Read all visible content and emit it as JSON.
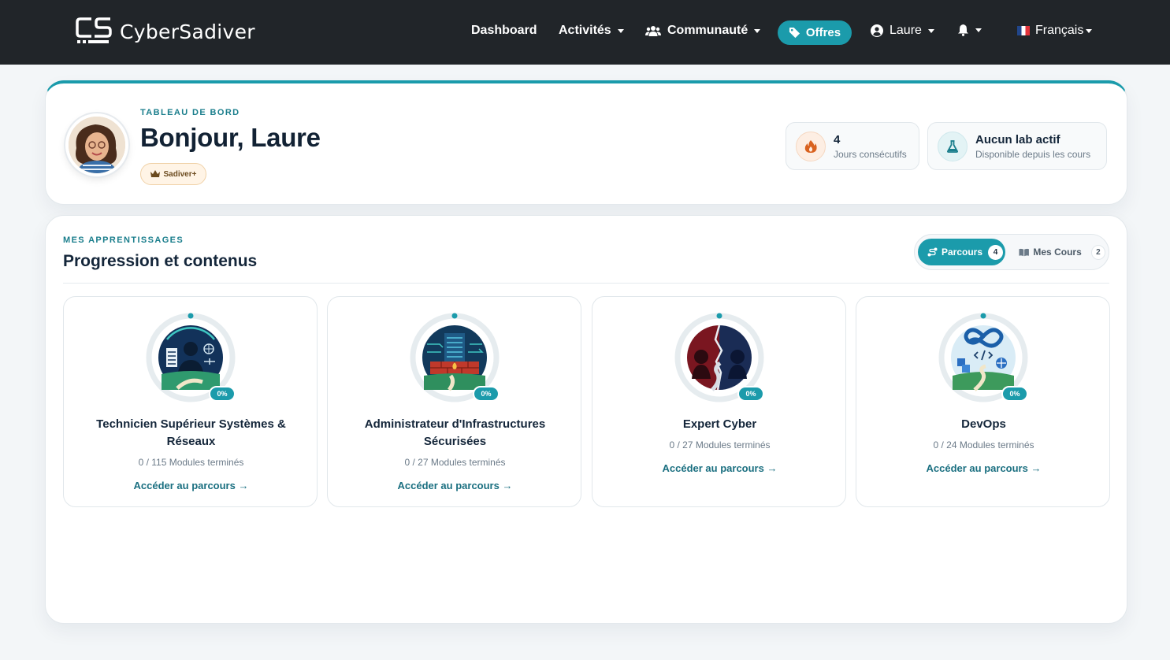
{
  "navbar": {
    "brand_name": "CyberSadiver",
    "items": {
      "dashboard": "Dashboard",
      "activites": "Activités",
      "communaute": "Communauté",
      "offres": "Offres",
      "user": "Laure",
      "language": "Français"
    },
    "icons": [
      "users-icon",
      "tag-icon",
      "user-circle-icon",
      "bell-icon",
      "flag-fr-icon"
    ]
  },
  "hero": {
    "eyebrow": "TABLEAU DE BORD",
    "greeting": "Bonjour, Laure",
    "badge": "Sadiver+",
    "streak": {
      "value": "4",
      "label": "Jours consécutifs"
    },
    "lab": {
      "value": "Aucun lab actif",
      "label": "Disponible depuis les cours"
    }
  },
  "learning": {
    "eyebrow": "MES APPRENTISSAGES",
    "title": "Progression et contenus",
    "toggle": {
      "parcours_label": "Parcours",
      "parcours_count": "4",
      "cours_label": "Mes Cours",
      "cours_count": "2"
    },
    "cta": "Accéder au parcours",
    "paths": [
      {
        "title": "Technicien Supérieur Systèmes & Réseaux",
        "progress": "0%",
        "modules": "0 / 115 Modules terminés"
      },
      {
        "title": "Administrateur d'Infrastructures Sécurisées",
        "progress": "0%",
        "modules": "0 / 27 Modules terminés"
      },
      {
        "title": "Expert Cyber",
        "progress": "0%",
        "modules": "0 / 27 Modules terminés"
      },
      {
        "title": "DevOps",
        "progress": "0%",
        "modules": "0 / 24 Modules terminés"
      }
    ]
  },
  "colors": {
    "accent": "#1b9bab",
    "navbar": "#212529",
    "link": "#1a6f80"
  }
}
